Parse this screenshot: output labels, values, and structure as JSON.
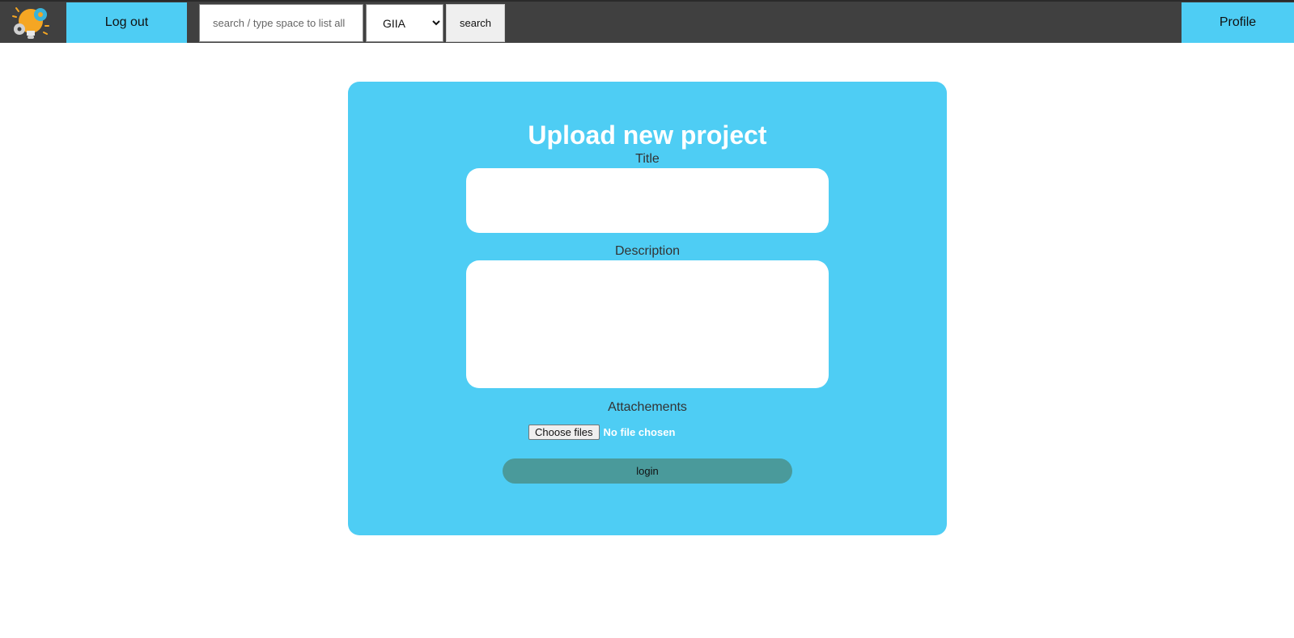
{
  "navbar": {
    "logout_label": "Log out",
    "search_placeholder": "search / type space to list all",
    "department_selected": "GIIA",
    "search_label": "search",
    "profile_label": "Profile"
  },
  "form": {
    "heading": "Upload new project",
    "title_label": "Title",
    "description_label": "Description",
    "attachments_label": "Attachements",
    "choose_files_label": "Choose files",
    "file_status": "No file chosen",
    "submit_label": "login"
  },
  "colors": {
    "navbar_bg": "#404040",
    "accent": "#4ecdf4",
    "submit_bg": "#4a9a9b"
  },
  "icons": {
    "logo": "lightbulb-gears-logo",
    "select_arrow": "chevron-down-icon"
  }
}
